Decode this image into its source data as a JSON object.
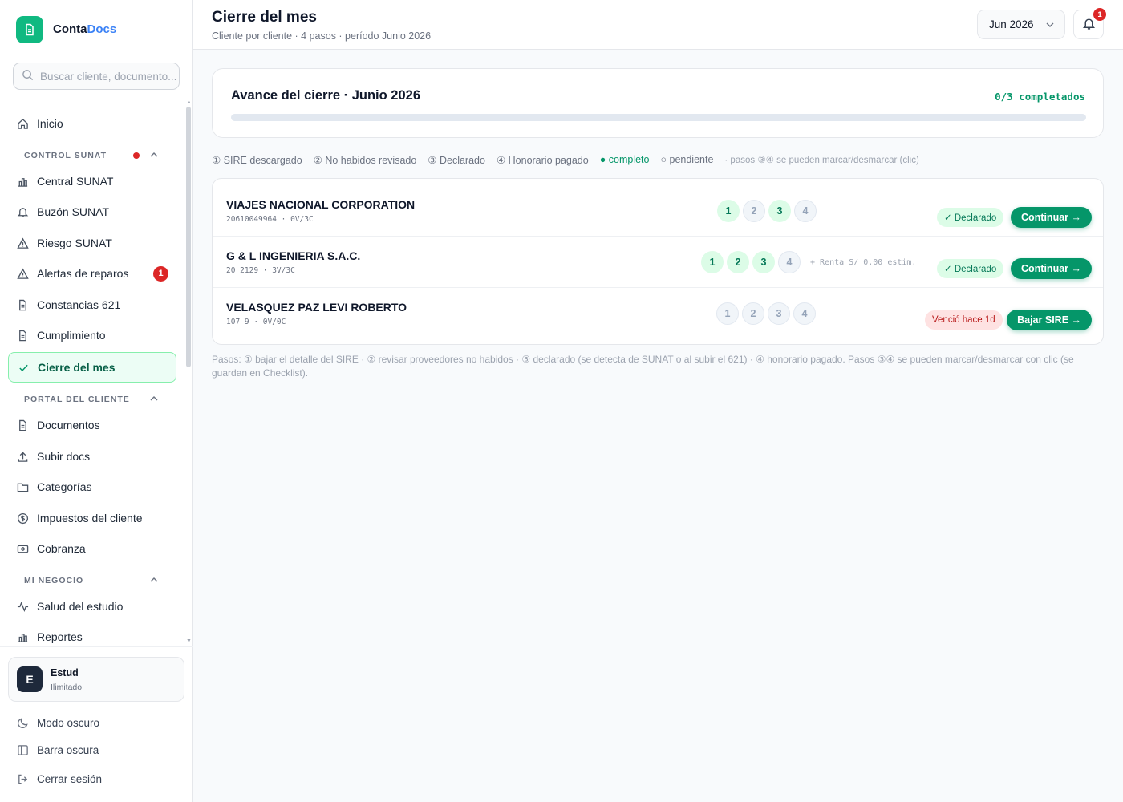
{
  "brand": {
    "name_part1": "Conta",
    "name_part2": "Docs"
  },
  "search": {
    "placeholder": "Buscar cliente, documento..."
  },
  "nav": {
    "inicio": "Inicio",
    "sections": {
      "control_sunat": "CONTROL SUNAT",
      "portal_cliente": "PORTAL DEL CLIENTE",
      "mi_negocio": "MI NEGOCIO"
    },
    "items": {
      "central_sunat": "Central SUNAT",
      "buzon_sunat": "Buzón SUNAT",
      "riesgo_sunat": "Riesgo SUNAT",
      "alertas_reparos": "Alertas de reparos",
      "alertas_badge": "1",
      "constancias": "Constancias 621",
      "cumplimiento": "Cumplimiento",
      "cierre_mes": "Cierre del mes",
      "documentos": "Documentos",
      "subir_docs": "Subir docs",
      "categorias": "Categorías",
      "impuestos": "Impuestos del cliente",
      "cobranza": "Cobranza",
      "salud": "Salud del estudio",
      "reportes": "Reportes"
    }
  },
  "account": {
    "initial": "E",
    "name": "Estud",
    "plan": "Ilimitado"
  },
  "footer": {
    "modo_oscuro": "Modo oscuro",
    "barra_oscura": "Barra oscura",
    "cerrar_sesion": "Cerrar sesión"
  },
  "header": {
    "title": "Cierre del mes",
    "subtitle": "Cliente por cliente · 4 pasos · período Junio 2026",
    "period": "Jun 2026",
    "notifications": "1"
  },
  "progress": {
    "title": "Avance del cierre · Junio 2026",
    "count": "0/3 completados",
    "fraction": 0
  },
  "legend": {
    "s1": "① SIRE descargado",
    "s2": "② No habidos revisado",
    "s3": "③ Declarado",
    "s4": "④ Honorario pagado",
    "completo": "● completo",
    "pendiente": "○ pendiente",
    "hint": "· pasos ③④ se pueden marcar/desmarcar (clic)"
  },
  "clients": [
    {
      "name": "VIAJES NACIONAL CORPORATION",
      "meta": "20610049964 · 0V/3C",
      "steps": [
        "1",
        "2",
        "3",
        "4"
      ],
      "steps_done": [
        true,
        false,
        true,
        false
      ],
      "renta": "",
      "status": "✓ Declarado",
      "status_kind": "ok",
      "action": "Continuar →"
    },
    {
      "name": "G & L INGENIERIA S.A.C.",
      "meta": "20     2129 · 3V/3C",
      "steps": [
        "1",
        "2",
        "3",
        "4"
      ],
      "steps_done": [
        true,
        true,
        true,
        false
      ],
      "renta": "+ Renta S/ 0.00 estim.",
      "status": "✓ Declarado",
      "status_kind": "ok",
      "action": "Continuar →"
    },
    {
      "name": "VELASQUEZ PAZ LEVI ROBERTO",
      "meta": "107       9 · 0V/0C",
      "steps": [
        "1",
        "2",
        "3",
        "4"
      ],
      "steps_done": [
        false,
        false,
        false,
        false
      ],
      "renta": "",
      "status": "Venció hace 1d",
      "status_kind": "late",
      "action": "Bajar SIRE →"
    }
  ],
  "footnote": "Pasos: ① bajar el detalle del SIRE · ② revisar proveedores no habidos · ③ declarado (se detecta de SUNAT o al subir el 621) · ④ honorario pagado. Pasos ③④ se pueden marcar/desmarcar con clic (se guardan en Checklist).",
  "colors": {
    "accent": "#10b981",
    "brand_blue": "#3b82f6",
    "danger": "#dc2626"
  }
}
